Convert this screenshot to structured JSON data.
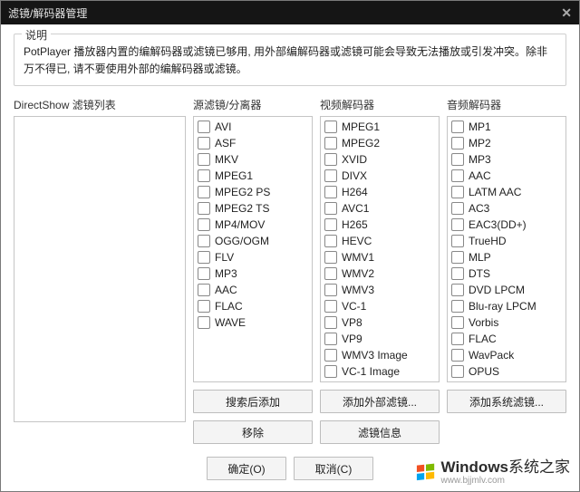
{
  "window": {
    "title": "滤镜/解码器管理"
  },
  "description": {
    "legend": "说明",
    "text": "PotPlayer 播放器内置的编解码器或滤镜已够用, 用外部编解码器或滤镜可能会导致无法播放或引发冲突。除非万不得已, 请不要使用外部的编解码器或滤镜。"
  },
  "columns": {
    "directshow": {
      "header": "DirectShow 滤镜列表"
    },
    "source": {
      "header": "源滤镜/分离器"
    },
    "video": {
      "header": "视频解码器"
    },
    "audio": {
      "header": "音频解码器"
    }
  },
  "source_items": [
    "AVI",
    "ASF",
    "MKV",
    "MPEG1",
    "MPEG2 PS",
    "MPEG2 TS",
    "MP4/MOV",
    "OGG/OGM",
    "FLV",
    "MP3",
    "AAC",
    "FLAC",
    "WAVE"
  ],
  "video_items": [
    "MPEG1",
    "MPEG2",
    "XVID",
    "DIVX",
    "H264",
    "AVC1",
    "H265",
    "HEVC",
    "WMV1",
    "WMV2",
    "WMV3",
    "VC-1",
    "VP8",
    "VP9",
    "WMV3 Image",
    "VC-1 Image"
  ],
  "audio_items": [
    "MP1",
    "MP2",
    "MP3",
    "AAC",
    "LATM AAC",
    "AC3",
    "EAC3(DD+)",
    "TrueHD",
    "MLP",
    "DTS",
    "DVD LPCM",
    "Blu-ray LPCM",
    "Vorbis",
    "FLAC",
    "WavPack",
    "OPUS"
  ],
  "buttons": {
    "search_add": "搜索后添加",
    "add_external": "添加外部滤镜...",
    "add_system": "添加系统滤镜...",
    "remove": "移除",
    "filter_info": "滤镜信息",
    "ok": "确定(O)",
    "cancel": "取消(C)"
  },
  "watermark": {
    "brand_bold": "Windows",
    "brand_rest": "系统之家",
    "url": "www.bjjmlv.com"
  }
}
